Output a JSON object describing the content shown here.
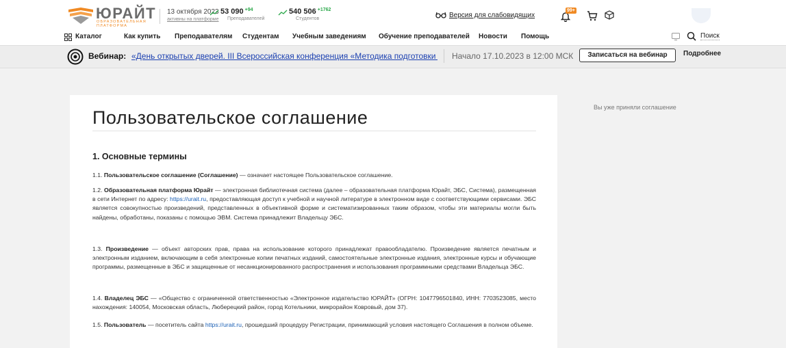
{
  "header": {
    "logo_text": "ЮРАЙТ",
    "logo_subtitle": "ОБРАЗОВАТЕЛЬНАЯ ПЛАТФОРМА",
    "date": "13 октября 2023",
    "date_sub": "активны на платформе",
    "stats": [
      {
        "value": "53 090",
        "delta": "+94",
        "label": "Преподавателей"
      },
      {
        "value": "540 506",
        "delta": "+1762",
        "label": "Студентов"
      }
    ],
    "accessible_version": "Версия для слабовидящих",
    "notif_badge": "99+",
    "search_label": "Поиск"
  },
  "nav": {
    "items": [
      "Каталог",
      "Как купить",
      "Преподавателям",
      "Студентам",
      "Учебным заведениям",
      "Обучение преподавателей",
      "Новости",
      "Помощь"
    ]
  },
  "webinar": {
    "label": "Вебинар:",
    "link": "«День открытых дверей. III Всероссийская конференция «Методика подготовки и",
    "date": "Начало 17.10.2023 в 12:00 МСК",
    "register_button": "Записаться на вебинар",
    "more_link": "Подробнее"
  },
  "side_note": "Вы уже приняли соглашение",
  "document": {
    "title": "Пользовательское соглашение",
    "section1_title": "1. Основные термины",
    "p1": {
      "num": "1.1.",
      "term": "Пользовательское соглашение (Соглашение)",
      "text": " — означает настоящее Пользовательское соглашение."
    },
    "p2": {
      "num": "1.2.",
      "term": "Образовательная платформа Юрайт",
      "text_a": " — электронная библиотечная система (далее – образовательная платформа Юрайт, ЭБС, Система), размещенная в сети Интернет по адресу: ",
      "link": "https://urait.ru",
      "text_b": ", предоставляющая доступ к учебной и научной литературе в электронном виде с соответствующими сервисами. ЭБС является совокупностью произведений, представленных в объективной форме и систематизированных таким образом, чтобы эти материалы могли быть найдены, обработаны, показаны с помощью ЭВМ. Система принадлежит Владельцу ЭБС."
    },
    "p3": {
      "num": "1.3.",
      "term": "Произведение",
      "text": " — объект авторских прав, права на использование которого принадлежат правообладателю. Произведение является печатным и электронным изданием, включающим в себя электронные копии печатных изданий, самостоятельные электронные издания, электронные курсы и обучающие программы, размещенные в ЭБС и защищенные от несанкционированного распространения и использования программными средствами Владельца ЭБС."
    },
    "p4": {
      "num": "1.4.",
      "term": "Владелец ЭБС",
      "text": " — «Общество с ограниченной ответственностью «Электронное издательство ЮРАЙТ» (ОГРН: 1047796501840, ИНН: 7703523085, место нахождения: 140054, Московская область, Люберецкий район, город Котельники, микрорайон Ковровый, дом 37)."
    },
    "p5": {
      "num": "1.5.",
      "term": "Пользователь",
      "text_a": " — посетитель сайта ",
      "link": "https://urait.ru",
      "text_b": ", прошедший процедуру Регистрации, принимающий условия настоящего Соглашения в полном объеме."
    }
  },
  "colors": {
    "accent_orange": "#f08a24",
    "link_blue": "#1a3fb0",
    "positive_green": "#2ba84a"
  }
}
